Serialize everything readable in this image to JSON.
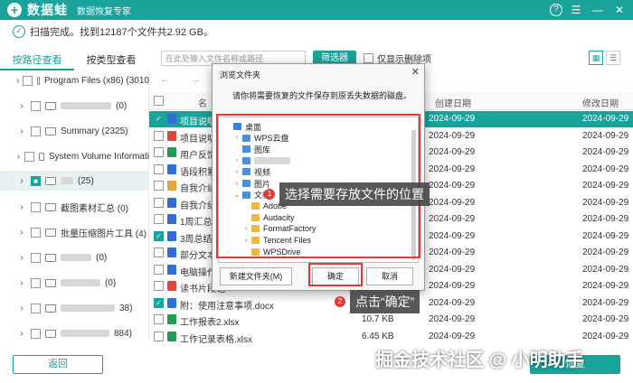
{
  "app": {
    "logo_glyph": "+",
    "name": "数据蛙",
    "subtitle": "数据恢复专家",
    "help_glyph": "?",
    "controls": [
      "☰",
      "—",
      "✕"
    ]
  },
  "status_text": "扫描完成。找到12187个文件共2.92 GB。",
  "tabs": [
    {
      "label": "按路径查看",
      "active": true
    },
    {
      "label": "按类型查看",
      "active": false
    }
  ],
  "toolbar": {
    "search_placeholder": "在此处输入文件名称或路径",
    "filter_label": "筛选器",
    "deleted_only_label": "仅显示删除项"
  },
  "sidebar": {
    "items": [
      {
        "label": "Program Files (x86) (3010",
        "blurred": false
      },
      {
        "label": "(0)",
        "blurred": true
      },
      {
        "label": "Summary (2325)",
        "blurred": false
      },
      {
        "label": "System Volume Informati",
        "blurred": false
      },
      {
        "label": "(25)",
        "blurred": true,
        "selected": true
      },
      {
        "label": "截图素材汇总 (0)",
        "blurred": false
      },
      {
        "label": "批量压缩图片工具 (4)",
        "blurred": false
      },
      {
        "label": "(0)",
        "blurred": true
      },
      {
        "label": "(0)",
        "blurred": true
      },
      {
        "label": "38)",
        "blurred": true
      },
      {
        "label": "884)",
        "blurred": true
      }
    ]
  },
  "nav_arrows": "← →",
  "columns": {
    "name": "名",
    "size": "",
    "created": "创建日期",
    "modified": "修改日期"
  },
  "files": [
    {
      "name": "项目说明书",
      "icon": "word",
      "size": "",
      "created": "2024-09-29",
      "modified": "2024-09-29",
      "checked": true,
      "selected": true
    },
    {
      "name": "项目说明书",
      "icon": "pdf",
      "size": "",
      "created": "2024-09-29",
      "modified": "2024-09-29",
      "checked": false
    },
    {
      "name": "用户反馈数",
      "icon": "xls",
      "size": "",
      "created": "2024-09-29",
      "modified": "2024-09-29",
      "checked": false
    },
    {
      "name": "语段积累.d",
      "icon": "word",
      "size": "",
      "created": "2024-09-29",
      "modified": "2024-09-29",
      "checked": false
    },
    {
      "name": "自我介绍.p",
      "icon": "wps",
      "size": "",
      "created": "2024-09-29",
      "modified": "2024-09-29",
      "checked": false
    },
    {
      "name": "自我介绍.tx",
      "icon": "word",
      "size": "",
      "created": "2024-09-29",
      "modified": "2024-09-29",
      "checked": false
    },
    {
      "name": "1周汇总.doc",
      "icon": "word",
      "size": "",
      "created": "2024-09-29",
      "modified": "2024-09-29",
      "checked": false
    },
    {
      "name": "3周总结.dc",
      "icon": "word",
      "size": "",
      "created": "2024-09-29",
      "modified": "2024-09-29",
      "checked": true
    },
    {
      "name": "部分文本模",
      "icon": "word",
      "size": "",
      "created": "2024-09-29",
      "modified": "2024-09-29",
      "checked": false
    },
    {
      "name": "电脑操作技",
      "icon": "word",
      "size": "",
      "created": "2024-09-29",
      "modified": "2024-09-29",
      "checked": false
    },
    {
      "name": "读书片段记",
      "icon": "pdf",
      "size": "",
      "created": "2024-09-29",
      "modified": "2024-09-29",
      "checked": false
    },
    {
      "name": "附：使用注意事项.docx",
      "icon": "word",
      "size": "12.0 KB",
      "created": "2024-09-29",
      "modified": "2024-09-29",
      "checked": true
    },
    {
      "name": "工作报表2.xlsx",
      "icon": "xls",
      "size": "10.7 KB",
      "created": "2024-09-29",
      "modified": "2024-09-29",
      "checked": false
    },
    {
      "name": "工作记录表格.xlsx",
      "icon": "xls",
      "size": "6.45 KB",
      "created": "2024-09-29",
      "modified": "2024-09-29",
      "checked": false
    }
  ],
  "buttons": {
    "back": "返回",
    "recover": "恢复"
  },
  "dialog": {
    "title": "浏览文件夹",
    "close_glyph": "✕",
    "prompt": "请你将需要恢复的文件保存到原丢失数据的磁盘。",
    "tree": [
      {
        "label": "桌面",
        "indent": 0,
        "chev": ""
      },
      {
        "label": "WPS云盘",
        "indent": 1,
        "chev": "›"
      },
      {
        "label": "图库",
        "indent": 1,
        "chev": ""
      },
      {
        "label": "",
        "indent": 1,
        "chev": "›",
        "blurred": true
      },
      {
        "label": "视频",
        "indent": 1,
        "chev": "›"
      },
      {
        "label": "图片",
        "indent": 1,
        "chev": "›"
      },
      {
        "label": "文档",
        "indent": 1,
        "chev": "⌄"
      },
      {
        "label": "Adobe",
        "indent": 2,
        "chev": ""
      },
      {
        "label": "Audacity",
        "indent": 2,
        "chev": ""
      },
      {
        "label": "FormatFactory",
        "indent": 2,
        "chev": "›"
      },
      {
        "label": "Tencent Files",
        "indent": 2,
        "chev": "›"
      },
      {
        "label": "WPSDrive",
        "indent": 2,
        "chev": ""
      }
    ],
    "new_folder_label": "新建文件夹(M)",
    "ok_label": "确定",
    "cancel_label": "取消"
  },
  "callouts": [
    {
      "number": "1",
      "text": "选择需要存放文件的位置"
    },
    {
      "number": "2",
      "text": "点击“确定”"
    }
  ],
  "watermark": "掘金技术社区 @ 小明助手",
  "colors": {
    "accent": "#1aa39b",
    "annotation_red": "#e53935"
  }
}
